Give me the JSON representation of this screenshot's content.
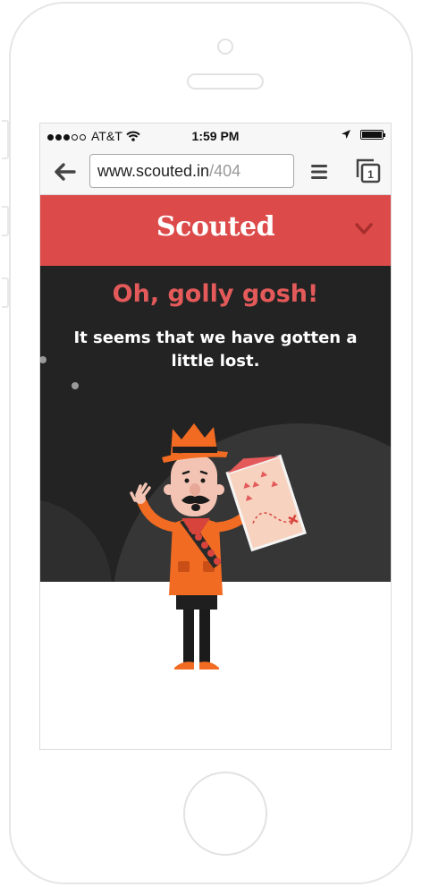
{
  "status_bar": {
    "carrier": "AT&T",
    "time": "1:59 PM",
    "signal_dots": 5,
    "signal_filled": 3,
    "icons": [
      "wifi-icon",
      "location-arrow-icon",
      "battery-icon"
    ]
  },
  "browser": {
    "url_domain": "www.scouted.in",
    "url_path": "/404",
    "tab_count": "1",
    "icons": [
      "back-arrow-icon",
      "hamburger-menu-icon",
      "tabs-icon"
    ]
  },
  "header": {
    "logo": "Scouted",
    "icons": [
      "chevron-down-icon"
    ]
  },
  "error": {
    "title": "Oh, golly gosh!",
    "message": "It seems that we have gotten a little lost."
  },
  "colors": {
    "brand_red": "#dd4a4a",
    "title_red": "#e45a5a",
    "dark_bg": "#232323",
    "scout_orange": "#f26b22"
  }
}
